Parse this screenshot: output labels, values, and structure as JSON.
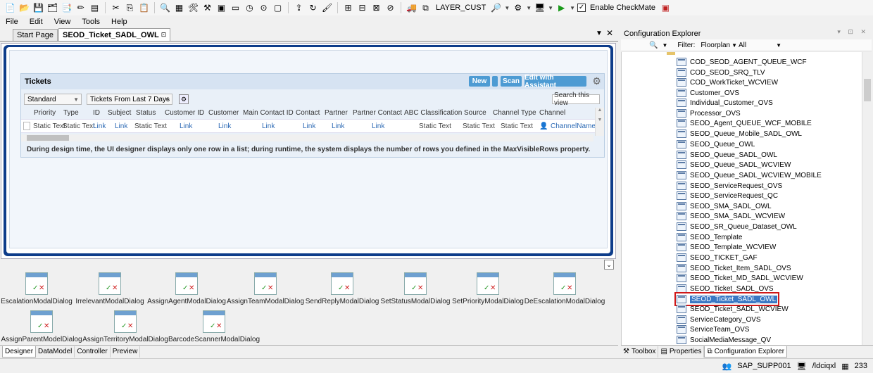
{
  "toolbar": {
    "layer_label": "LAYER_CUST",
    "checkmate_label": "Enable CheckMate",
    "checkmate_checked": true
  },
  "menu": [
    "File",
    "Edit",
    "View",
    "Tools",
    "Help"
  ],
  "doc_tabs": [
    {
      "label": "Start Page",
      "active": false
    },
    {
      "label": "SEOD_Ticket_SADL_OWL",
      "active": true
    }
  ],
  "tickets": {
    "title": "Tickets",
    "btn_new": "New",
    "btn_scan": "Scan",
    "btn_edit": "Edit with Assistant",
    "select_variant": "Standard",
    "select_period": "Tickets From Last 7 Days",
    "search_placeholder": "Search this view",
    "columns": [
      "Priority",
      "Type",
      "ID",
      "Subject",
      "Status",
      "Customer ID",
      "Customer",
      "Main Contact ID",
      "Contact",
      "Partner",
      "Partner Contact",
      "ABC Classification",
      "Source",
      "Channel Type",
      "Channel"
    ],
    "row": [
      "Static Text",
      "Static Text",
      "Link",
      "Link",
      "Static Text",
      "Link",
      "Link",
      "Link",
      "Link",
      "Link",
      "Link",
      "Static Text",
      "Static Text",
      "Static Text",
      "ChannelName"
    ],
    "note": "During design time, the UI designer displays only one row in a list; during runtime, the system displays the number of rows you defined in the MaxVisibleRows property."
  },
  "dialogs": [
    "EscalationModalDialog",
    "IrrelevantModalDialog",
    "AssignAgentModalDialog",
    "AssignTeamModalDialog",
    "SendReplyModalDialog",
    "SetStatusModalDialog",
    "SetPriorityModalDialog",
    "DeEscalationModalDialog",
    "AssignParentModelDialog",
    "AssignTerritoryModalDialog",
    "BarcodeScannerModalDialog"
  ],
  "bottom_tabs": [
    "Designer",
    "DataModel",
    "Controller",
    "Preview"
  ],
  "config_explorer": {
    "title": "Configuration Explorer",
    "filter_label": "Filter:",
    "filter_value": "Floorplan",
    "filter_all": "All",
    "selected": "SEOD_Ticket_SADL_OWL",
    "items": [
      "COD_SEOD_AGENT_QUEUE_WCF",
      "COD_SEOD_SRQ_TLV",
      "COD_WorkTicket_WCVIEW",
      "Customer_OVS",
      "Individual_Customer_OVS",
      "Processor_OVS",
      "SEOD_Agent_QUEUE_WCF_MOBILE",
      "SEOD_Queue_Mobile_SADL_OWL",
      "SEOD_Queue_OWL",
      "SEOD_Queue_SADL_OWL",
      "SEOD_Queue_SADL_WCVIEW",
      "SEOD_Queue_SADL_WCVIEW_MOBILE",
      "SEOD_ServiceRequest_OVS",
      "SEOD_ServiceRequest_QC",
      "SEOD_SMA_SADL_OWL",
      "SEOD_SMA_SADL_WCVIEW",
      "SEOD_SR_Queue_Dataset_OWL",
      "SEOD_Template",
      "SEOD_Template_WCVIEW",
      "SEOD_TICKET_GAF",
      "SEOD_Ticket_Item_SADL_OVS",
      "SEOD_Ticket_MD_SADL_WCVIEW",
      "SEOD_Ticket_SADL_OVS",
      "SEOD_Ticket_SADL_OWL",
      "SEOD_Ticket_SADL_WCVIEW",
      "ServiceCategory_OVS",
      "ServiceTeam_OVS",
      "SocialMediaMessage_QV"
    ]
  },
  "explorer_tabs": [
    "Toolbox",
    "Properties",
    "Configuration Explorer"
  ],
  "status": {
    "user": "SAP_SUPP001",
    "system": "/ldciqxl",
    "count": "233"
  }
}
